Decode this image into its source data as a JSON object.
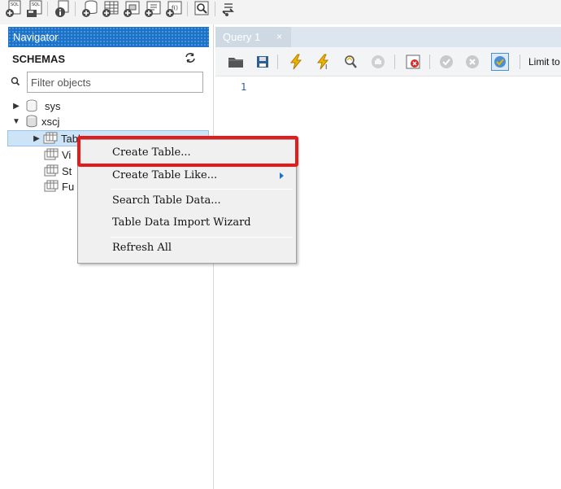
{
  "toolbar": {
    "icons": [
      "new-sql-tab-icon",
      "open-sql-file-icon",
      "info-icon",
      "create-schema-icon",
      "create-table-icon",
      "create-view-icon",
      "create-procedure-icon",
      "create-function-icon",
      "search-table-data-icon",
      "reconnect-icon"
    ],
    "badge_sql_1": "SQL",
    "badge_sql_2": "SQL",
    "badge_fn": "f()"
  },
  "navigator": {
    "header": "Navigator",
    "schemas_label": "SCHEMAS",
    "filter_placeholder": "Filter objects",
    "tree": {
      "sys": "sys",
      "xscj": "xscj",
      "tables_partial": "Tabl",
      "views_partial": "Vi",
      "stored_procs_partial": "St",
      "functions_partial": "Fu"
    }
  },
  "query": {
    "tab_label": "Query 1",
    "tab_close": "×",
    "limit_label": "Limit to",
    "line_number": "1"
  },
  "context_menu": {
    "items": [
      "Create Table...",
      "Create Table Like...",
      "Search Table Data...",
      "Table Data Import Wizard",
      "Refresh All"
    ]
  },
  "colors": {
    "navigator_header": "#1a73c9",
    "highlight": "#e31b1b",
    "selected_row": "#cde4f7",
    "query_tab": "#cfd9e4"
  }
}
